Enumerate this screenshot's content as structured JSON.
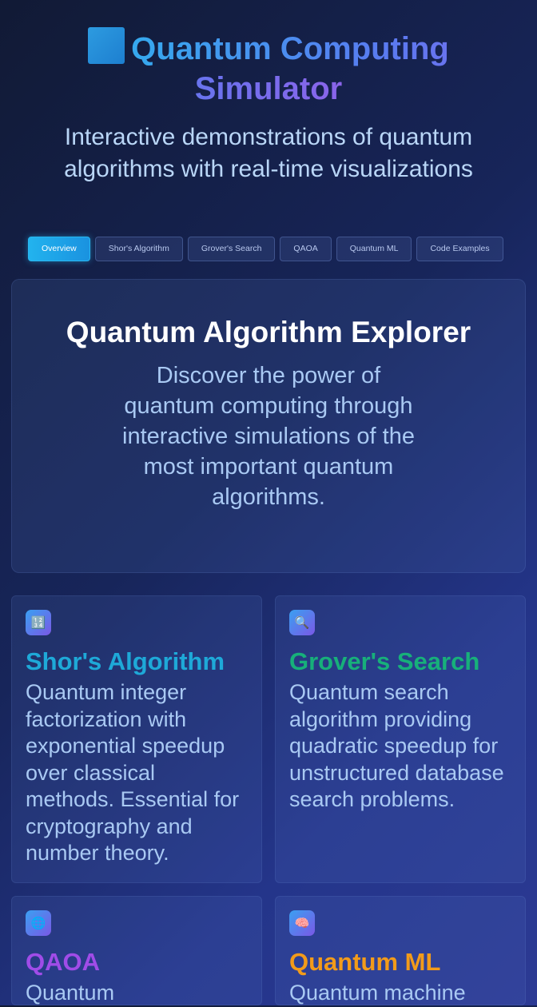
{
  "header": {
    "title": "Quantum Computing Simulator",
    "subtitle": "Interactive demonstrations of quantum algorithms with real-time visualizations"
  },
  "tabs": [
    {
      "label": "Overview",
      "active": true
    },
    {
      "label": "Shor's Algorithm",
      "active": false
    },
    {
      "label": "Grover's Search",
      "active": false
    },
    {
      "label": "QAOA",
      "active": false
    },
    {
      "label": "Quantum ML",
      "active": false
    },
    {
      "label": "Code Examples",
      "active": false
    }
  ],
  "hero": {
    "title": "Quantum Algorithm Explorer",
    "text": "Discover the power of quantum computing through interactive simulations of the most important quantum algorithms."
  },
  "cards": [
    {
      "icon": "🔢",
      "icon_name": "numbers-icon",
      "title": "Shor's Algorithm",
      "color": "#1ea9d8",
      "text": "Quantum integer factorization with exponential speedup over classical methods. Essential for cryptography and number theory."
    },
    {
      "icon": "🔍",
      "icon_name": "magnifier-icon",
      "title": "Grover's Search",
      "color": "#17b07a",
      "text": "Quantum search algorithm providing quadratic speedup for unstructured database search problems."
    },
    {
      "icon": "🌐",
      "icon_name": "globe-icon",
      "title": "QAOA",
      "color": "#a04ce8",
      "text": "Quantum"
    },
    {
      "icon": "🧠",
      "icon_name": "brain-icon",
      "title": "Quantum ML",
      "color": "#f29b1a",
      "text": "Quantum machine"
    }
  ]
}
